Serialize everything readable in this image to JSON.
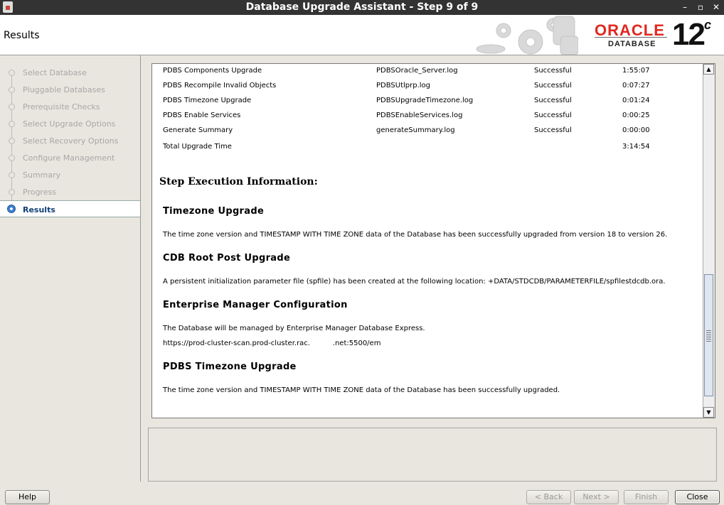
{
  "window": {
    "title": "Database Upgrade Assistant - Step 9 of 9",
    "controls": [
      "–",
      "▫",
      "✕"
    ]
  },
  "header": {
    "page_title": "Results",
    "brand": "ORACLE",
    "product": "DATABASE",
    "version": "12",
    "version_sup": "c"
  },
  "sidebar": {
    "items": [
      {
        "label": "Select Database",
        "state": "done"
      },
      {
        "label": "Pluggable Databases",
        "state": "done"
      },
      {
        "label": "Prerequisite Checks",
        "state": "done"
      },
      {
        "label": "Select Upgrade Options",
        "state": "done"
      },
      {
        "label": "Select Recovery Options",
        "state": "done"
      },
      {
        "label": "Configure Management",
        "state": "done"
      },
      {
        "label": "Summary",
        "state": "done"
      },
      {
        "label": "Progress",
        "state": "done"
      },
      {
        "label": "Results",
        "state": "active"
      }
    ]
  },
  "results": {
    "rows": [
      {
        "step": "PDBS Components Upgrade",
        "log": "PDBSOracle_Server.log",
        "status": "Successful",
        "time": "1:55:07"
      },
      {
        "step": "PDBS Recompile Invalid Objects",
        "log": "PDBSUtlprp.log",
        "status": "Successful",
        "time": "0:07:27"
      },
      {
        "step": "PDBS Timezone Upgrade",
        "log": "PDBSUpgradeTimezone.log",
        "status": "Successful",
        "time": "0:01:24"
      },
      {
        "step": "PDBS Enable Services",
        "log": "PDBSEnableServices.log",
        "status": "Successful",
        "time": "0:00:25"
      },
      {
        "step": "Generate Summary",
        "log": "generateSummary.log",
        "status": "Successful",
        "time": "0:00:00"
      }
    ],
    "total_label": "Total Upgrade Time",
    "total_time": "3:14:54",
    "section_heading": "Step Execution Information:",
    "sections": [
      {
        "title": "Timezone Upgrade",
        "text": "The time zone version and TIMESTAMP WITH TIME ZONE data of the Database has been successfully upgraded from version 18 to version 26."
      },
      {
        "title": "CDB Root Post Upgrade",
        "text": "A persistent initialization parameter file (spfile) has been created at the following location: +DATA/STDCDB/PARAMETERFILE/spfilestdcdb.ora."
      },
      {
        "title": "Enterprise Manager Configuration",
        "text": "The Database will be managed by Enterprise Manager Database Express.",
        "url": "https://prod-cluster-scan.prod-cluster.rac.          .net:5500/em"
      },
      {
        "title": "PDBS Timezone Upgrade",
        "text": "The time zone version and TIMESTAMP WITH TIME ZONE data of the Database has been successfully upgraded."
      }
    ]
  },
  "buttons": {
    "help": "Help",
    "back": "< Back",
    "next": "Next >",
    "finish": "Finish",
    "close": "Close"
  }
}
